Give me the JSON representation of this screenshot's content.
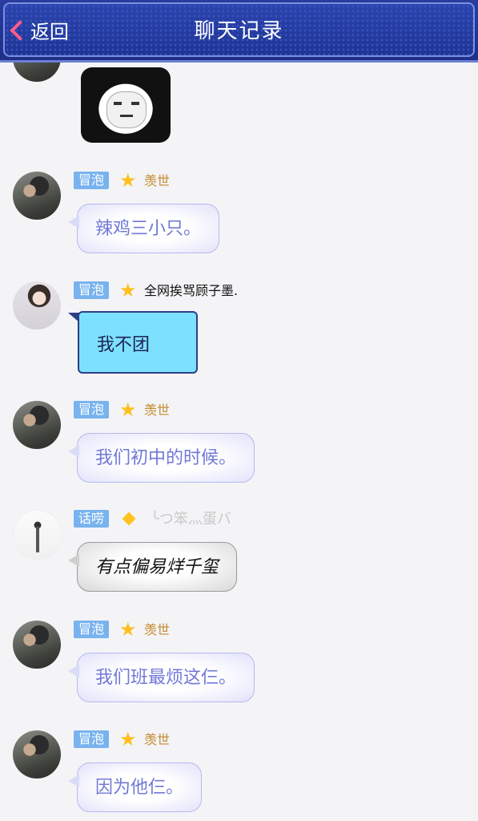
{
  "header": {
    "back_label": "返回",
    "title": "聊天记录"
  },
  "messages": [
    {
      "id": "m1",
      "badge": "冒泡",
      "name": "羡世",
      "text": "辣鸡三小只。"
    },
    {
      "id": "m2",
      "badge": "冒泡",
      "name": "全网挨骂顾子墨.",
      "text": "我不团"
    },
    {
      "id": "m3",
      "badge": "冒泡",
      "name": "羡世",
      "text": "我们初中的时候。"
    },
    {
      "id": "m4",
      "badge": "话唠",
      "name": "╰つ笨灬蛋バ",
      "text": "有点偏易烊千玺"
    },
    {
      "id": "m5",
      "badge": "冒泡",
      "name": "羡世",
      "text": "我们班最烦这仨。"
    },
    {
      "id": "m6",
      "badge": "冒泡",
      "name": "羡世",
      "text": "因为他仨。"
    }
  ],
  "colors": {
    "header_bg": "#1f3595",
    "badge_bg": "#78b3ee",
    "lavender_text": "#7079d6",
    "cyan_bubble": "#7de1fd"
  }
}
